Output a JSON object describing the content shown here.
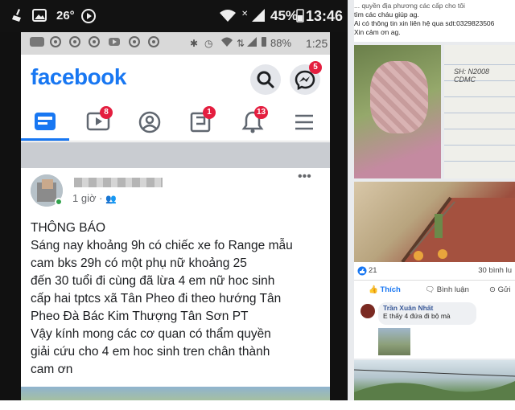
{
  "outer_status": {
    "temperature": "26°",
    "battery_pct": "45%",
    "time": "13:46",
    "icons": [
      "broom-icon",
      "image-icon",
      "youtube-icon",
      "wifi-icon",
      "signal-icon",
      "battery-icon"
    ]
  },
  "inner_status": {
    "battery_pct": "88%",
    "time": "1:25",
    "icons": [
      "chat-icon",
      "chrome-icon",
      "bluetooth-icon",
      "alarm-icon",
      "wifi-icon",
      "signal-icon",
      "battery-icon"
    ]
  },
  "facebook": {
    "logo": "facebook",
    "messenger_badge": "5",
    "brand_color": "#1877f2",
    "tabs": [
      {
        "name": "home",
        "icon": "news-feed-icon",
        "badge": ""
      },
      {
        "name": "watch",
        "icon": "video-icon",
        "badge": "8"
      },
      {
        "name": "profile",
        "icon": "profile-icon",
        "badge": ""
      },
      {
        "name": "pages",
        "icon": "flag-icon",
        "badge": "1"
      },
      {
        "name": "notifications",
        "icon": "bell-icon",
        "badge": "13"
      },
      {
        "name": "menu",
        "icon": "hamburger-icon",
        "badge": ""
      }
    ]
  },
  "post": {
    "time": "1 giờ ·",
    "lines": [
      "THÔNG BÁO",
      "Sáng nay khoảng 9h có chiếc xe fo Range mẫu",
      "cam bks 29h          có một phụ nữ khoảng 25",
      "đến 30 tuổi đi cùng đã  lừa 4 em nữ  hoc sinh",
      "cấp hai tptcs xã Tân Pheo đi theo hướng Tân",
      "Pheo Đà Bác Kim Thượng Tân Sơn PT",
      " Vậy kính mong các cơ quan có thẩm quyền",
      "giải cứu cho 4 em hoc sinh tren chân thành",
      "cam ơn"
    ]
  },
  "right": {
    "top_text": [
      "... quyền địa phương các cấp cho tôi",
      "tìm các cháu giúp ag.",
      "Ai có thông tin xin liên hệ qua sdt:0329823506",
      "Xin cảm ơn ag."
    ],
    "notebook_text": "SH: N2008\nCDMC",
    "reactions_count": "21",
    "comments_count": "30 bình lu",
    "actions": [
      "Thích",
      "Bình luận",
      "Gửi"
    ],
    "comment": {
      "name": "Trần Xuân Nhất",
      "text": "E thấy 4 đứa đi bộ mà"
    }
  }
}
